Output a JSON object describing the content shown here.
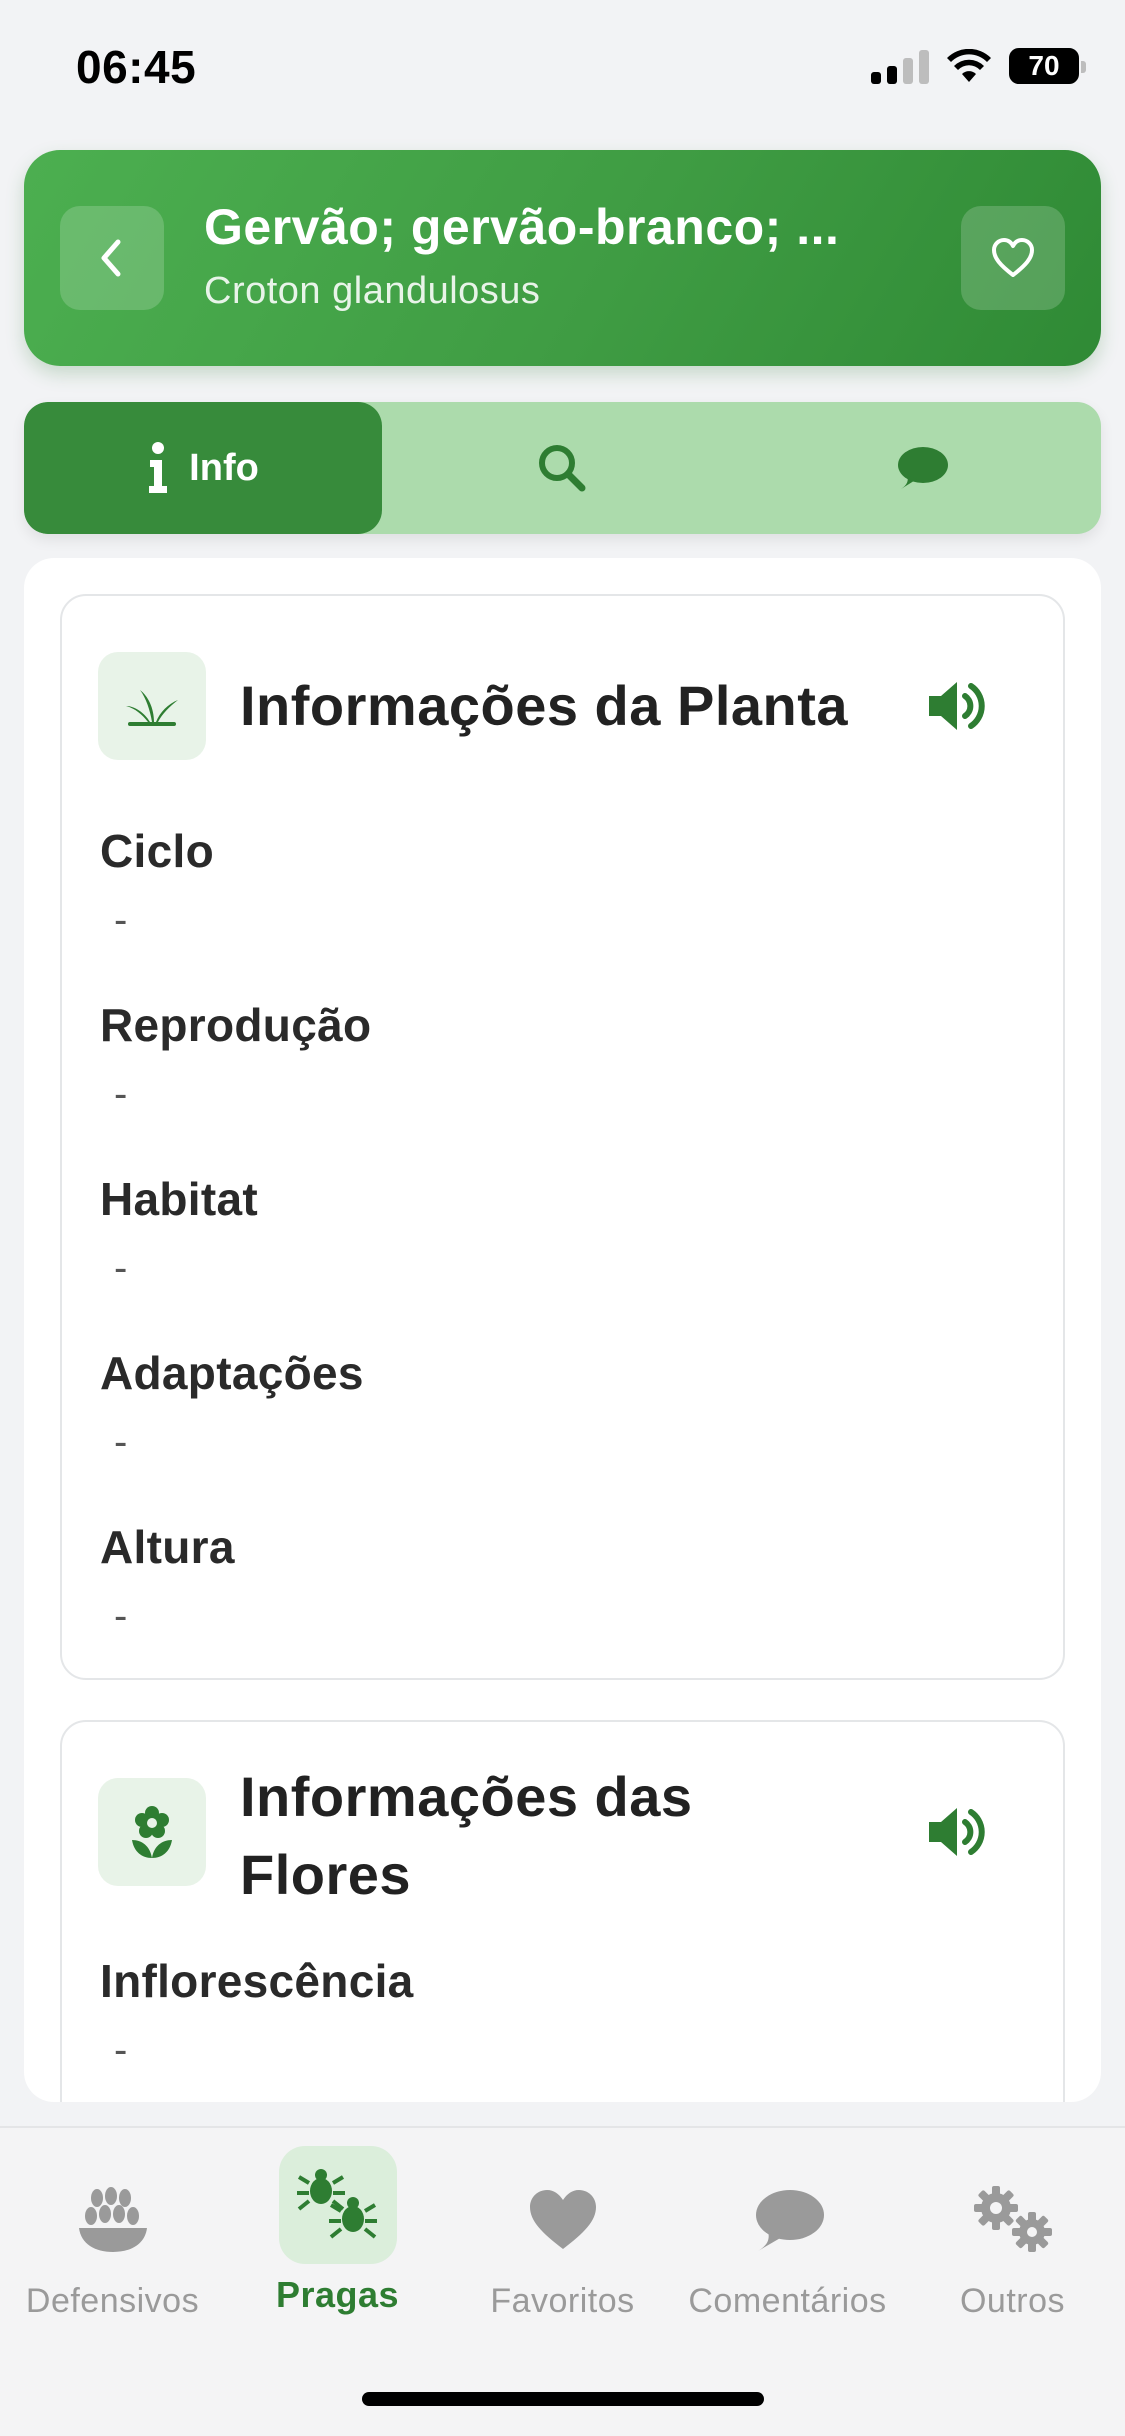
{
  "status_bar": {
    "time": "06:45",
    "battery": "70"
  },
  "header": {
    "title": "Gervão; gervão-branco; ...",
    "subtitle": "Croton glandulosus"
  },
  "tabs": [
    {
      "label": "Info",
      "icon": "info-icon",
      "active": true
    },
    {
      "label": "",
      "icon": "search-icon",
      "active": false
    },
    {
      "label": "",
      "icon": "comment-icon",
      "active": false
    }
  ],
  "sections": {
    "plant": {
      "title": "Informações da Planta",
      "icon": "plant-icon",
      "fields": [
        {
          "label": "Ciclo",
          "value": "-"
        },
        {
          "label": "Reprodução",
          "value": "-"
        },
        {
          "label": "Habitat",
          "value": "-"
        },
        {
          "label": "Adaptações",
          "value": "-"
        },
        {
          "label": "Altura",
          "value": "-"
        }
      ]
    },
    "flowers": {
      "title_line1": "Informações das",
      "title_line2": "Flores",
      "icon": "flower-icon",
      "fields": [
        {
          "label": "Inflorescência",
          "value": "-"
        }
      ]
    }
  },
  "bottom_nav": [
    {
      "label": "Defensivos",
      "icon": "seeds-icon",
      "active": false
    },
    {
      "label": "Pragas",
      "icon": "bugs-icon",
      "active": true
    },
    {
      "label": "Favoritos",
      "icon": "heart-icon",
      "active": false
    },
    {
      "label": "Comentários",
      "icon": "comment-icon",
      "active": false
    },
    {
      "label": "Outros",
      "icon": "gears-icon",
      "active": false
    }
  ],
  "colors": {
    "primary": "#2e7d32",
    "header_gradient_start": "#4caf50",
    "tab_active": "#378b3b",
    "tab_bg": "#acdbac",
    "inactive_nav": "#9a9a9a"
  }
}
